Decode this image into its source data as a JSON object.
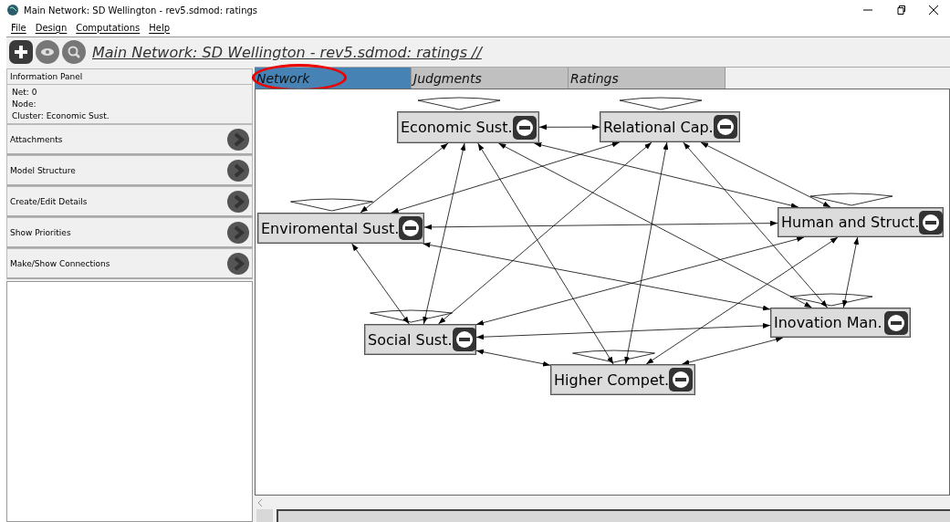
{
  "window": {
    "title": "Main Network: SD Wellington - rev5.sdmod: ratings"
  },
  "menu": [
    "File",
    "Design",
    "Computations",
    "Help"
  ],
  "toolbar": {
    "title": "Main Network: SD Wellington - rev5.sdmod: ratings //"
  },
  "info_panel": {
    "title": "Information Panel",
    "lines": [
      "Net: 0",
      "Node:",
      "Cluster: Economic Sust."
    ]
  },
  "sections": [
    {
      "label": "Attachments"
    },
    {
      "label": "Model Structure"
    },
    {
      "label": "Create/Edit Details"
    },
    {
      "label": "Show Priorities"
    },
    {
      "label": "Make/Show Connections"
    }
  ],
  "tabs": [
    {
      "label": "Network",
      "selected": true
    },
    {
      "label": "Judgments",
      "selected": false
    },
    {
      "label": "Ratings",
      "selected": false
    }
  ],
  "nodes": [
    {
      "label": "Economic Sust."
    },
    {
      "label": "Relational Cap."
    },
    {
      "label": "Enviromental Sust."
    },
    {
      "label": "Human and Struct."
    },
    {
      "label": "Inovation Man."
    },
    {
      "label": "Social Sust."
    },
    {
      "label": "Higher Compet."
    }
  ]
}
